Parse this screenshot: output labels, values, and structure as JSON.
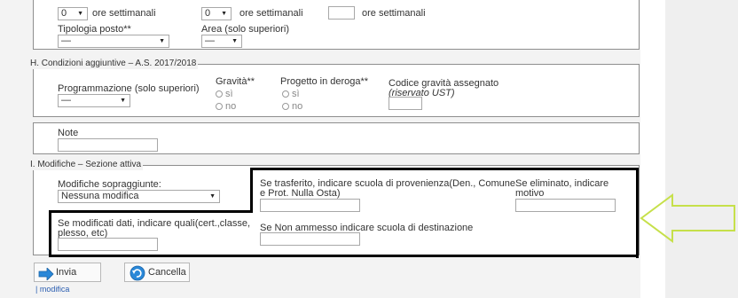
{
  "top_row": {
    "sel1_value": "0",
    "sel1_label": "ore settimanali",
    "sel2_value": "0",
    "sel2_label": "ore settimanali",
    "input_label": "ore settimanali"
  },
  "posto": {
    "tipologia_label": "Tipologia posto**",
    "tipologia_value": "—",
    "area_label": "Area (solo superiori)",
    "area_value": "—"
  },
  "section_h": {
    "legend": "H. Condizioni aggiuntive – A.S. 2017/2018",
    "programmazione_label": "Programmazione (solo superiori)",
    "programmazione_value": "—",
    "gravita_label": "Gravità**",
    "gravita_si": "sì",
    "gravita_no": "no",
    "progetto_label": "Progetto in deroga**",
    "progetto_si": "sì",
    "progetto_no": "no",
    "codice_label": "Codice gravità assegnato",
    "codice_sublabel": "(riservato UST)"
  },
  "note": {
    "label": "Note"
  },
  "section_i": {
    "legend": "I. Modifiche – Sezione attiva",
    "modifiche_label": "Modifiche sopraggiunte:",
    "modifiche_value": "Nessuna modifica",
    "trasferito_label_1": "Se trasferito, indicare scuola di provenienza(Den., Comune",
    "trasferito_label_2": "e Prot. Nulla Osta)",
    "eliminato_label_1": "Se eliminato, indicare",
    "eliminato_label_2": "motivo",
    "modificati_label_1": "Se modificati dati, indicare quali(cert.,classe,",
    "modificati_label_2": "plesso, etc)",
    "non_ammesso_label": "Se Non ammesso indicare scuola di destinazione"
  },
  "buttons": {
    "invia": "Invia",
    "cancella": "Cancella",
    "modifica_link": "| modifica"
  },
  "colors": {
    "annotation_black": "#000000",
    "arrow_green": "#c6e04a",
    "invia_icon": "#2a88d8",
    "cancella_icon": "#2a88d8"
  }
}
